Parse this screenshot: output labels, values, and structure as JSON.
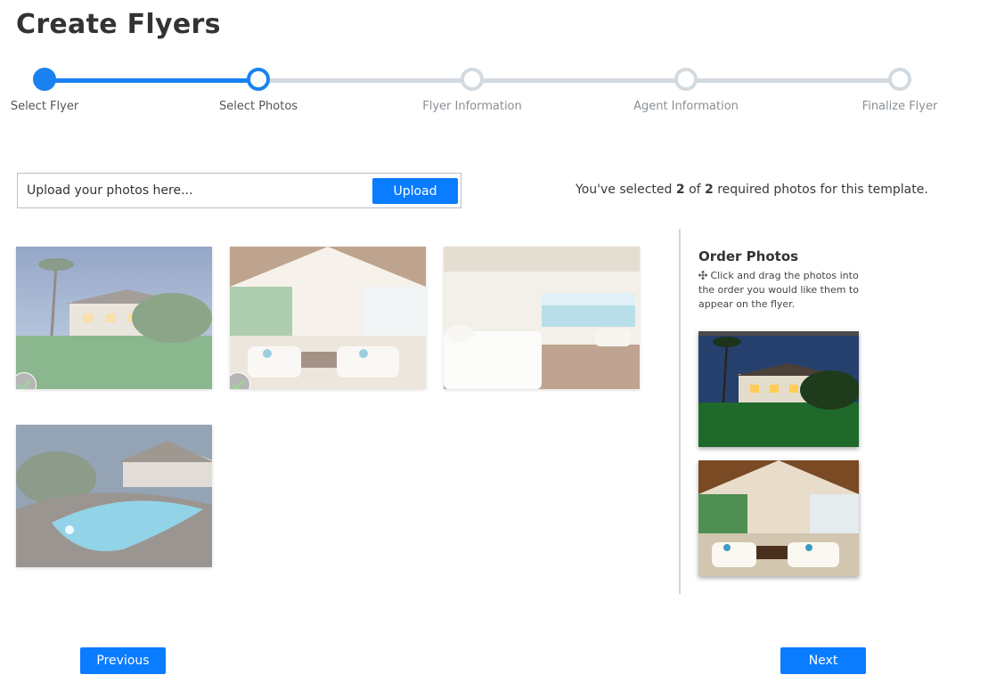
{
  "page": {
    "title": "Create Flyers"
  },
  "stepper": {
    "steps": [
      {
        "label": "Select Flyer",
        "state": "done"
      },
      {
        "label": "Select Photos",
        "state": "current"
      },
      {
        "label": "Flyer Information",
        "state": "upcoming"
      },
      {
        "label": "Agent Information",
        "state": "upcoming"
      },
      {
        "label": "Finalize Flyer",
        "state": "upcoming"
      }
    ],
    "accent_color": "#1a82f0",
    "inactive_color": "#d3dadf"
  },
  "upload": {
    "placeholder": "Upload your photos here...",
    "button_label": "Upload"
  },
  "selection": {
    "prefix": "You've selected ",
    "selected": "2",
    "middle": " of ",
    "required": "2",
    "suffix": " required photos for this template."
  },
  "photos": [
    {
      "name": "house-exterior-lawn",
      "selected": true
    },
    {
      "name": "great-room-interior",
      "selected": true
    },
    {
      "name": "ocean-view-bedroom",
      "selected": false
    },
    {
      "name": "pool-at-dusk",
      "selected": false
    }
  ],
  "order_panel": {
    "title": "Order Photos",
    "icon": "move-icon",
    "help_text": "Click and drag the photos into the order you would like them to appear on the flyer.",
    "ordered": [
      "house-exterior-lawn",
      "great-room-interior"
    ]
  },
  "nav": {
    "previous_label": "Previous",
    "next_label": "Next"
  },
  "colors": {
    "button_blue": "#0a7cff",
    "check_gray": "#7c7c7c",
    "check_green": "#4caf50"
  }
}
